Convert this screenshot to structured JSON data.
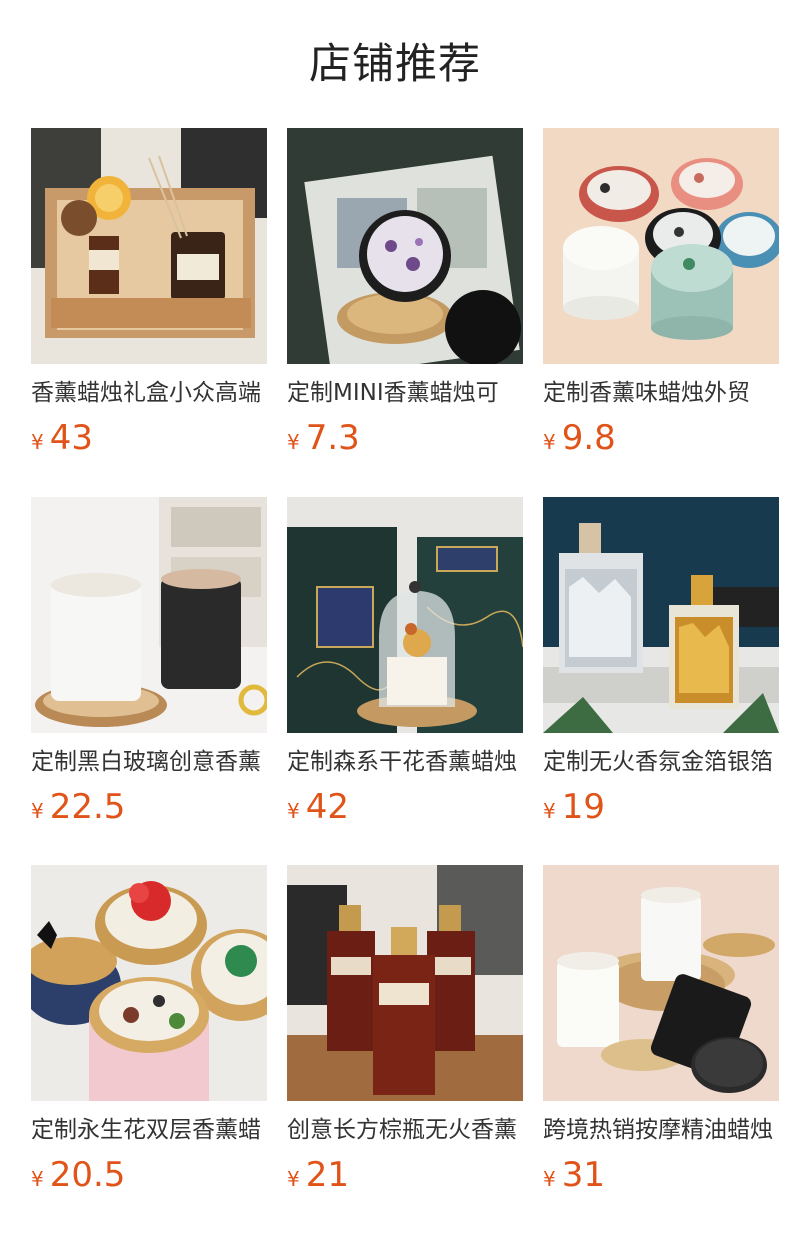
{
  "page_title": "店铺推荐",
  "currency_symbol": "¥",
  "accent_color": "#e0541a",
  "products": [
    {
      "name": "香薰蜡烛礼盒小众高端",
      "price": "43",
      "image": "candle-gift-box-image"
    },
    {
      "name": "定制MINI香薰蜡烛可",
      "price": "7.3",
      "image": "mini-crystal-candle-image"
    },
    {
      "name": "定制香薰味蜡烛外贸",
      "price": "9.8",
      "image": "colorful-crystal-candles-image"
    },
    {
      "name": "定制黑白玻璃创意香薰",
      "price": "22.5",
      "image": "black-white-glass-candles-image"
    },
    {
      "name": "定制森系干花香薰蜡烛",
      "price": "42",
      "image": "dried-flower-dome-candle-image"
    },
    {
      "name": "定制无火香氛金箔银箔",
      "price": "19",
      "image": "gold-silver-foil-diffuser-image"
    },
    {
      "name": "定制永生花双层香薰蜡",
      "price": "20.5",
      "image": "preserved-flower-tin-candles-image"
    },
    {
      "name": "创意长方棕瓶无火香薰",
      "price": "21",
      "image": "brown-rectangular-diffuser-image"
    },
    {
      "name": "跨境热销按摩精油蜡烛",
      "price": "31",
      "image": "massage-oil-candles-image"
    }
  ]
}
